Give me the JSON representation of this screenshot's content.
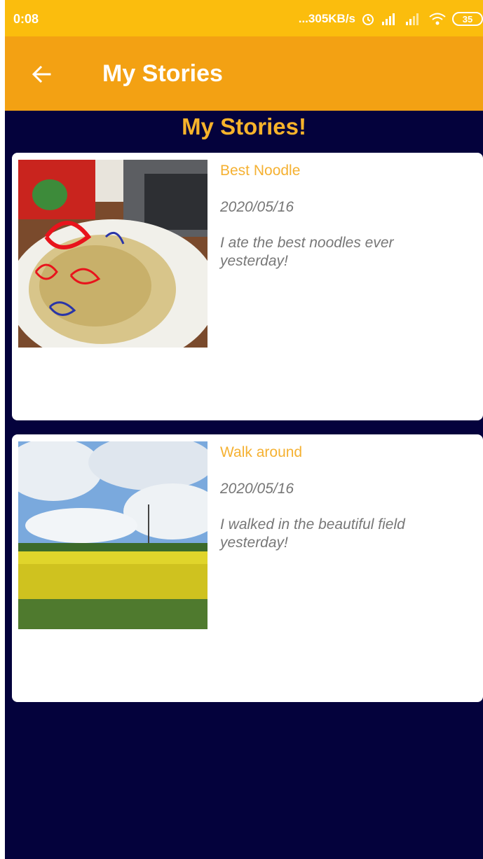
{
  "status_bar": {
    "time": "0:08",
    "network_speed": "...305KB/s",
    "battery_level": "35",
    "icons": [
      "alarm-icon",
      "signal-icon",
      "wifi-icon",
      "battery-icon"
    ]
  },
  "app_bar": {
    "title": "My Stories",
    "back_icon": "arrow-left-icon",
    "background": "#f3a113"
  },
  "section_title": "My Stories!",
  "stories": [
    {
      "title": "Best Noodle",
      "date": "2020/05/16",
      "text": "I ate the best noodles ever yesterday!",
      "image": "noodle-photo"
    },
    {
      "title": "Walk around",
      "date": "2020/05/16",
      "text": "I walked in the beautiful field yesterday!",
      "image": "field-photo"
    }
  ],
  "colors": {
    "status_bar": "#fbbd0d",
    "page_background": "#04023c",
    "accent": "#f7b32b"
  }
}
